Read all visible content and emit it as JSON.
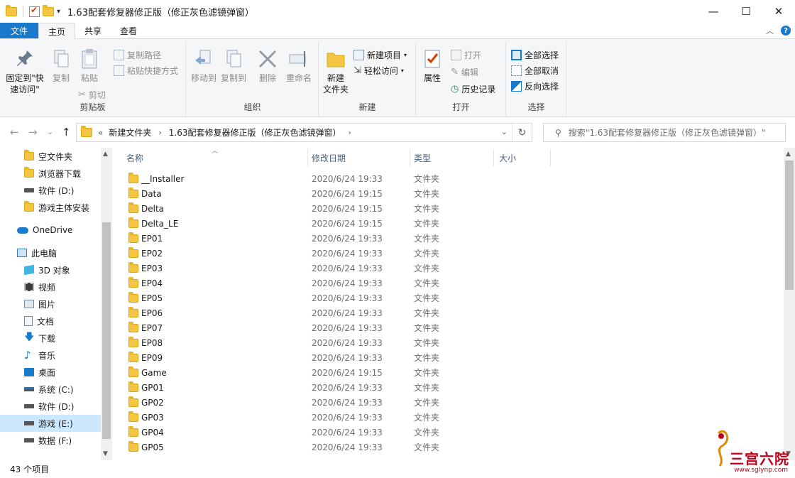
{
  "window": {
    "title": "1.63配套修复器修正版（修正灰色滤镜弹窗）",
    "min_glyph": "—",
    "max_glyph": "☐",
    "close_glyph": "✕"
  },
  "tabs": [
    {
      "label": "文件"
    },
    {
      "label": "主页"
    },
    {
      "label": "共享"
    },
    {
      "label": "查看"
    }
  ],
  "tab_controls": {
    "collapse_glyph": "︿",
    "help_glyph": "?"
  },
  "ribbon": {
    "clipboard": {
      "label": "剪贴板",
      "pin_line1": "固定到\"快",
      "pin_line2": "速访问\"",
      "copy": "复制",
      "paste": "粘贴",
      "copy_path": "复制路径",
      "paste_shortcut": "粘贴快捷方式",
      "cut": "剪切"
    },
    "organize": {
      "label": "组织",
      "move_to": "移动到",
      "copy_to": "复制到",
      "delete": "删除",
      "rename": "重命名"
    },
    "new": {
      "label": "新建",
      "new_folder_line1": "新建",
      "new_folder_line2": "文件夹",
      "new_item": "新建项目",
      "easy_access": "轻松访问"
    },
    "open": {
      "label": "打开",
      "properties": "属性",
      "open": "打开",
      "edit": "编辑",
      "history": "历史记录"
    },
    "select": {
      "label": "选择",
      "select_all": "全部选择",
      "select_none": "全部取消",
      "invert": "反向选择"
    }
  },
  "address": {
    "back_glyph": "←",
    "forward_glyph": "→",
    "recent_glyph": "⌄",
    "up_glyph": "↑",
    "overflow": "«",
    "segments": [
      "新建文件夹",
      "1.63配套修复器修正版（修正灰色滤镜弹窗）"
    ],
    "chevron": "›",
    "dropdown": "⌄",
    "refresh_glyph": "↻"
  },
  "search": {
    "placeholder": "搜索\"1.63配套修复器修正版（修正灰色滤镜弹窗）\""
  },
  "nav": {
    "items": [
      {
        "label": "空文件夹",
        "icon": "folder-icon"
      },
      {
        "label": "浏览器下载",
        "icon": "folder-icon"
      },
      {
        "label": "软件 (D:)",
        "icon": "drive-icon"
      },
      {
        "label": "游戏主体安装",
        "icon": "folder-icon"
      },
      {
        "label": "OneDrive",
        "icon": "cloud-icon"
      },
      {
        "label": "此电脑",
        "icon": "computer-icon"
      },
      {
        "label": "3D 对象",
        "icon": "cube-icon"
      },
      {
        "label": "视频",
        "icon": "film-icon"
      },
      {
        "label": "图片",
        "icon": "picture-icon"
      },
      {
        "label": "文档",
        "icon": "document-icon"
      },
      {
        "label": "下载",
        "icon": "download-icon"
      },
      {
        "label": "音乐",
        "icon": "music-icon"
      },
      {
        "label": "桌面",
        "icon": "desktop-icon"
      },
      {
        "label": "系统 (C:)",
        "icon": "system-drive-icon"
      },
      {
        "label": "软件 (D:)",
        "icon": "drive-icon"
      },
      {
        "label": "游戏 (E:)",
        "icon": "drive-icon"
      },
      {
        "label": "数据 (F:)",
        "icon": "drive-icon"
      }
    ]
  },
  "columns": {
    "name": "名称",
    "date": "修改日期",
    "type": "类型",
    "size": "大小"
  },
  "files": [
    {
      "name": "__Installer",
      "date": "2020/6/24 19:33",
      "type": "文件夹"
    },
    {
      "name": "Data",
      "date": "2020/6/24 19:15",
      "type": "文件夹"
    },
    {
      "name": "Delta",
      "date": "2020/6/24 19:15",
      "type": "文件夹"
    },
    {
      "name": "Delta_LE",
      "date": "2020/6/24 19:15",
      "type": "文件夹"
    },
    {
      "name": "EP01",
      "date": "2020/6/24 19:33",
      "type": "文件夹"
    },
    {
      "name": "EP02",
      "date": "2020/6/24 19:33",
      "type": "文件夹"
    },
    {
      "name": "EP03",
      "date": "2020/6/24 19:33",
      "type": "文件夹"
    },
    {
      "name": "EP04",
      "date": "2020/6/24 19:33",
      "type": "文件夹"
    },
    {
      "name": "EP05",
      "date": "2020/6/24 19:33",
      "type": "文件夹"
    },
    {
      "name": "EP06",
      "date": "2020/6/24 19:33",
      "type": "文件夹"
    },
    {
      "name": "EP07",
      "date": "2020/6/24 19:33",
      "type": "文件夹"
    },
    {
      "name": "EP08",
      "date": "2020/6/24 19:33",
      "type": "文件夹"
    },
    {
      "name": "EP09",
      "date": "2020/6/24 19:33",
      "type": "文件夹"
    },
    {
      "name": "Game",
      "date": "2020/6/24 19:15",
      "type": "文件夹"
    },
    {
      "name": "GP01",
      "date": "2020/6/24 19:33",
      "type": "文件夹"
    },
    {
      "name": "GP02",
      "date": "2020/6/24 19:33",
      "type": "文件夹"
    },
    {
      "name": "GP03",
      "date": "2020/6/24 19:33",
      "type": "文件夹"
    },
    {
      "name": "GP04",
      "date": "2020/6/24 19:33",
      "type": "文件夹"
    },
    {
      "name": "GP05",
      "date": "2020/6/24 19:33",
      "type": "文件夹"
    }
  ],
  "status": {
    "item_count": "43 个项目"
  },
  "watermark": {
    "text": "三宫六院",
    "url": "www.sglynp.com"
  },
  "colors": {
    "accent": "#1979ca",
    "folder": "#f4c542",
    "selected": "#cce8ff"
  }
}
